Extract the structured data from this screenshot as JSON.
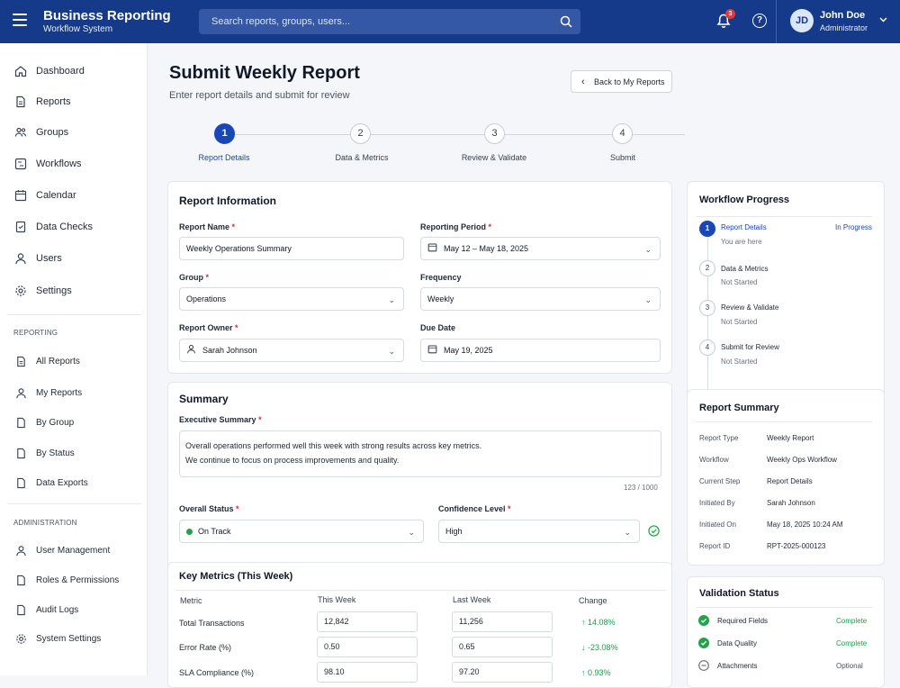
{
  "header": {
    "title": "Business Reporting",
    "subtitle": "Workflow System",
    "search_placeholder": "Search reports, groups, users...",
    "notification_count": "3",
    "help": "?",
    "user": {
      "initials": "JD",
      "name": "John Doe",
      "role": "Administrator"
    }
  },
  "sidebar": {
    "main_items": [
      {
        "label": "Dashboard",
        "icon": "home-icon"
      },
      {
        "label": "Reports",
        "icon": "document-icon"
      },
      {
        "label": "Groups",
        "icon": "users-group-icon"
      },
      {
        "label": "Workflows",
        "icon": "workflow-icon"
      },
      {
        "label": "Calendar",
        "icon": "calendar-icon"
      },
      {
        "label": "Data Checks",
        "icon": "check-document-icon"
      },
      {
        "label": "Users",
        "icon": "user-icon"
      },
      {
        "label": "Settings",
        "icon": "gear-icon"
      }
    ],
    "reporting_heading": "REPORTING",
    "reporting_items": [
      {
        "label": "All Reports",
        "icon": "document-icon"
      },
      {
        "label": "My Reports",
        "icon": "user-icon"
      },
      {
        "label": "By Group",
        "icon": "document-icon"
      },
      {
        "label": "By Status",
        "icon": "document-icon"
      },
      {
        "label": "Data Exports",
        "icon": "document-icon"
      }
    ],
    "admin_heading": "ADMINISTRATION",
    "admin_items": [
      {
        "label": "User Management",
        "icon": "user-icon"
      },
      {
        "label": "Roles & Permissions",
        "icon": "document-icon"
      },
      {
        "label": "Audit Logs",
        "icon": "document-icon"
      },
      {
        "label": "System Settings",
        "icon": "gear-icon"
      }
    ]
  },
  "page": {
    "title": "Submit Weekly Report",
    "subtitle": "Enter report details and submit for review",
    "back_button": "Back to My Reports"
  },
  "stepper": [
    {
      "num": "1",
      "label": "Report Details",
      "active": true
    },
    {
      "num": "2",
      "label": "Data & Metrics",
      "active": false
    },
    {
      "num": "3",
      "label": "Review & Validate",
      "active": false
    },
    {
      "num": "4",
      "label": "Submit",
      "active": false
    }
  ],
  "report_info": {
    "title": "Report Information",
    "report_name_label": "Report Name",
    "report_name_value": "Weekly Operations Summary",
    "period_label": "Reporting Period",
    "period_value": "May 12 – May 18, 2025",
    "group_label": "Group",
    "group_value": "Operations",
    "frequency_label": "Frequency",
    "frequency_value": "Weekly",
    "owner_label": "Report Owner",
    "owner_value": "Sarah Johnson",
    "due_label": "Due Date",
    "due_value": "May 19, 2025",
    "required_mark": "*"
  },
  "summary": {
    "title": "Summary",
    "exec_label": "Executive Summary",
    "exec_line1": "Overall operations performed well this week with strong results across key metrics.",
    "exec_line2": "We continue to focus on process improvements and quality.",
    "counter": "123 / 1000",
    "status_label": "Overall Status",
    "status_value": "On Track",
    "confidence_label": "Confidence Level",
    "confidence_value": "High",
    "status_color": "#22a249"
  },
  "metrics": {
    "title": "Key Metrics (This Week)",
    "headers": [
      "Metric",
      "This Week",
      "Last Week",
      "Change"
    ],
    "rows": [
      {
        "metric": "Total Transactions",
        "this_week": "12,842",
        "last_week": "11,256",
        "change": "↑ 14.08%"
      },
      {
        "metric": "Error Rate (%)",
        "this_week": "0.50",
        "last_week": "0.65",
        "change": "↓ -23.08%"
      },
      {
        "metric": "SLA Compliance (%)",
        "this_week": "98.10",
        "last_week": "97.20",
        "change": "↑ 0.93%"
      }
    ]
  },
  "workflow": {
    "title": "Workflow Progress",
    "steps": [
      {
        "num": "1",
        "name": "Report Details",
        "status": "You are here",
        "tag": "In Progress",
        "active": true
      },
      {
        "num": "2",
        "name": "Data & Metrics",
        "status": "Not Started",
        "tag": "",
        "active": false
      },
      {
        "num": "3",
        "name": "Review & Validate",
        "status": "Not Started",
        "tag": "",
        "active": false
      },
      {
        "num": "4",
        "name": "Submit for Review",
        "status": "Not Started",
        "tag": "",
        "active": false
      }
    ]
  },
  "report_summary": {
    "title": "Report Summary",
    "rows": [
      {
        "k": "Report Type",
        "v": "Weekly Report"
      },
      {
        "k": "Workflow",
        "v": "Weekly Ops Workflow"
      },
      {
        "k": "Current Step",
        "v": "Report Details"
      },
      {
        "k": "Initiated By",
        "v": "Sarah Johnson"
      },
      {
        "k": "Initiated On",
        "v": "May 18, 2025 10:24 AM"
      },
      {
        "k": "Report ID",
        "v": "RPT-2025-000123"
      }
    ]
  },
  "validation": {
    "title": "Validation Status",
    "rows": [
      {
        "k": "Required Fields",
        "v": "Complete"
      },
      {
        "k": "Data Quality",
        "v": "Complete"
      },
      {
        "k": "Attachments",
        "v": "Optional"
      }
    ]
  },
  "colors": {
    "primary": "#163a8a",
    "accent": "#1a47b8",
    "success": "#16a34a",
    "danger": "#d32f2f"
  }
}
